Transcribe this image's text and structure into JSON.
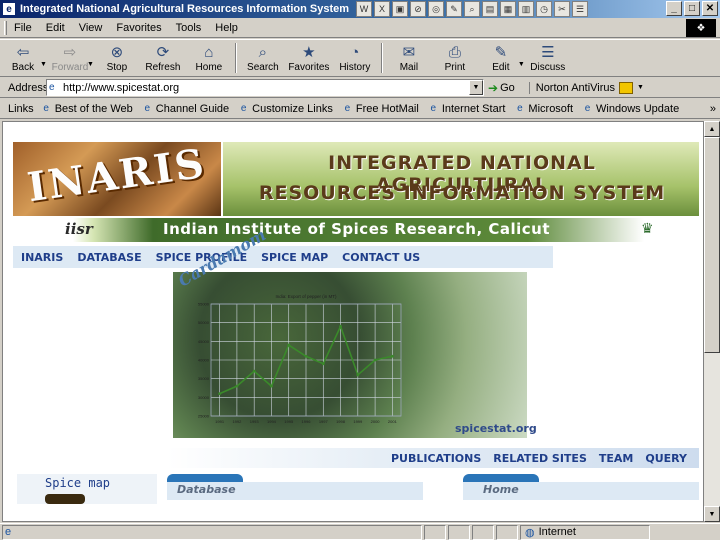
{
  "window": {
    "title": "Integrated National Agricultural Resources Information System",
    "app_icon": "ie-page-icon",
    "taskbar_icons": [
      "W",
      "X",
      "▣",
      "⊘",
      "◎",
      "✎",
      "⌕",
      "▤",
      "▦",
      "▥",
      "◷",
      "✂",
      "☰"
    ],
    "buttons": {
      "minimize": "_",
      "maximize": "□",
      "close": "✕"
    }
  },
  "menu": {
    "items": [
      "File",
      "Edit",
      "View",
      "Favorites",
      "Tools",
      "Help"
    ]
  },
  "toolbar": {
    "back": "Back",
    "forward": "Forward",
    "stop": "Stop",
    "refresh": "Refresh",
    "home": "Home",
    "search": "Search",
    "favorites": "Favorites",
    "history": "History",
    "mail": "Mail",
    "print": "Print",
    "edit": "Edit",
    "discuss": "Discuss"
  },
  "address": {
    "label": "Address",
    "value": "http://www.spicestat.org",
    "go": "Go",
    "norton": "Norton AntiVirus"
  },
  "links": {
    "label": "Links",
    "items": [
      "Best of the Web",
      "Channel Guide",
      "Customize Links",
      "Free HotMail",
      "Internet Start",
      "Microsoft",
      "Windows Update"
    ],
    "more": "»"
  },
  "page": {
    "banner_logo": "INARIS",
    "banner_title_line1": "INTEGRATED NATIONAL AGRICULTURAL",
    "banner_title_line2": "RESOURCES INFORMATION SYSTEM",
    "iisr_logo": "iisr",
    "iisr_name": "Indian Institute of Spices Research, Calicut",
    "topnav": [
      "INARIS",
      "DATABASE",
      "SPICE PROFILE",
      "SPICE MAP",
      "CONTACT US"
    ],
    "photo_caption": "Cardamom",
    "site_mark": "spicestat.org",
    "bottomnav": [
      "PUBLICATIONS",
      "RELATED SITES",
      "TEAM",
      "QUERY"
    ],
    "spice_map_label": "Spice map",
    "database_label": "Database",
    "home_label": "Home"
  },
  "chart_data": {
    "type": "line",
    "title": "India: Export of pepper (in MT)",
    "xlabel": "",
    "ylabel": "",
    "x": [
      "1991",
      "1992",
      "1993",
      "1994",
      "1995",
      "1996",
      "1997",
      "1998",
      "1999",
      "2000",
      "2001"
    ],
    "values": [
      31000,
      33000,
      37000,
      33000,
      44000,
      41000,
      39000,
      49000,
      36000,
      40000,
      41000
    ],
    "yticks": [
      "25000",
      "30000",
      "35000",
      "40000",
      "45000",
      "50000",
      "55000"
    ],
    "ylim": [
      25000,
      55000
    ],
    "grid": true,
    "color": "#3a8a2a"
  },
  "status": {
    "left": "",
    "zone": "Internet"
  },
  "colors": {
    "titlebar": "#0a246a",
    "nav_text": "#1f3e8a",
    "accent": "#2a75b8"
  }
}
